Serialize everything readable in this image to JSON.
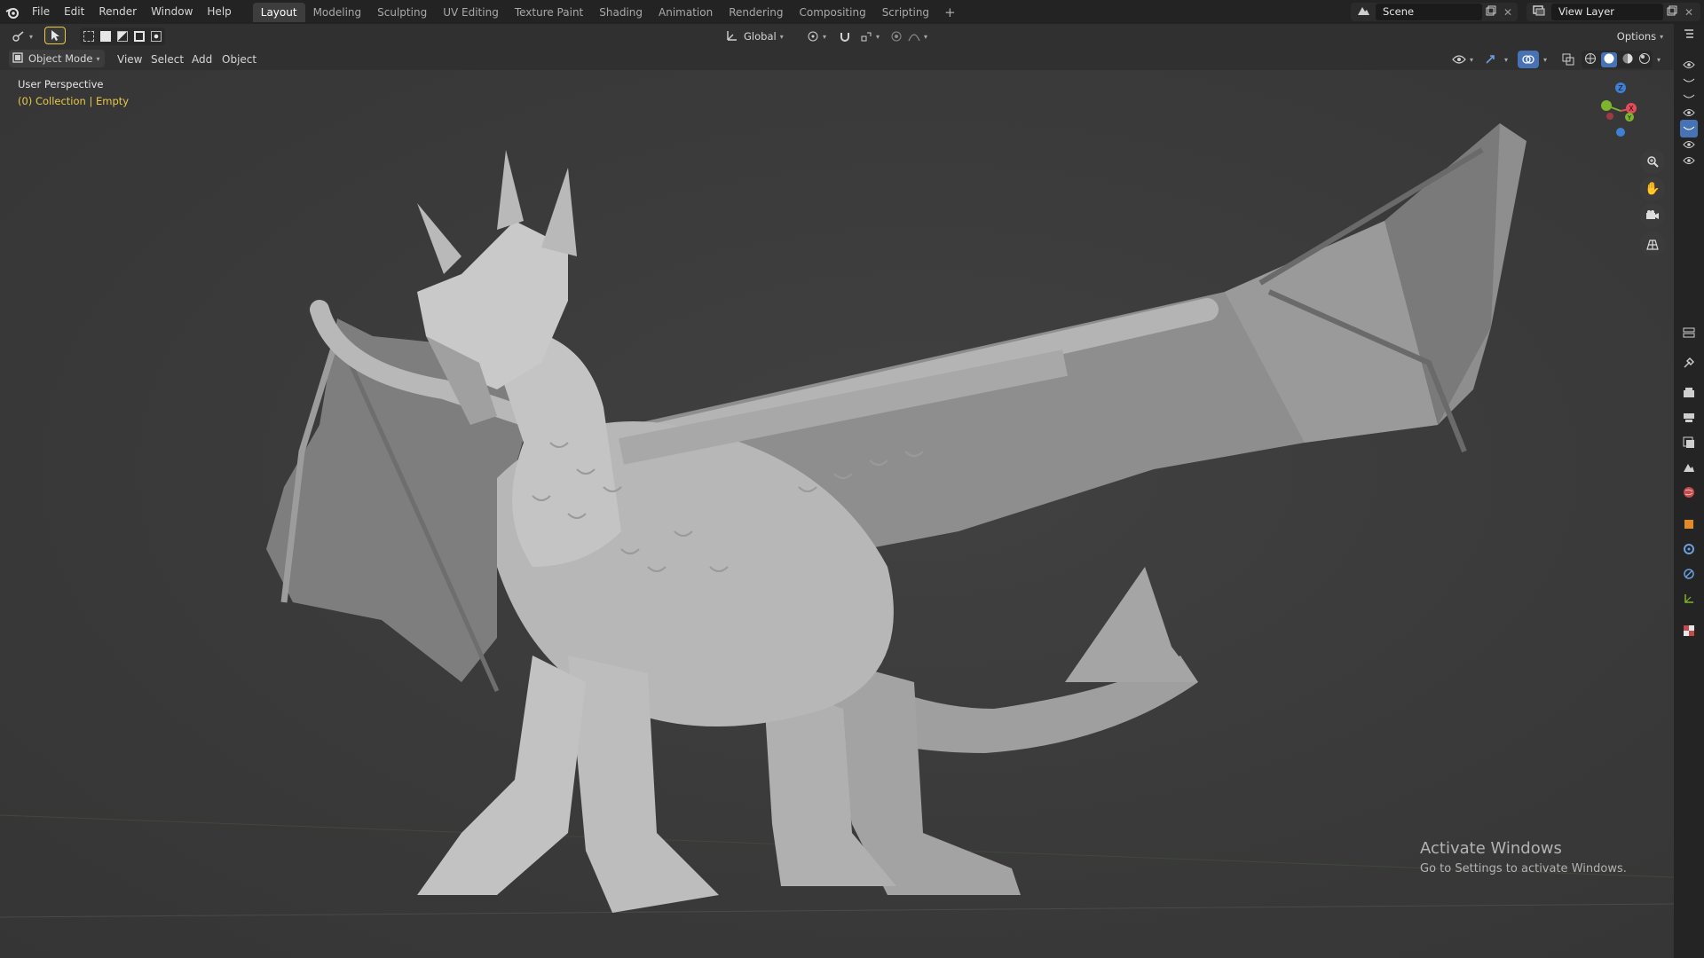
{
  "topbar": {
    "menus": [
      "File",
      "Edit",
      "Render",
      "Window",
      "Help"
    ],
    "workspaces": [
      "Layout",
      "Modeling",
      "Sculpting",
      "UV Editing",
      "Texture Paint",
      "Shading",
      "Animation",
      "Rendering",
      "Compositing",
      "Scripting"
    ],
    "active_workspace": "Layout",
    "add_workspace": "+",
    "scene_name": "Scene",
    "view_layer_name": "View Layer"
  },
  "header": {
    "transform_orientation": "Global",
    "options_label": "Options",
    "mode": "Object Mode",
    "view_menus": [
      "View",
      "Select",
      "Add",
      "Object"
    ]
  },
  "viewport": {
    "perspective_label": "User Perspective",
    "collection_label": "(0) Collection | Empty",
    "gizmo_axes": [
      "Z",
      "X",
      "Y"
    ],
    "watermark_title": "Activate Windows",
    "watermark_sub": "Go to Settings to activate Windows."
  },
  "colors": {
    "accent": "#4772b3",
    "collection_text": "#e8c94a",
    "axis_x": "#e44c5a",
    "axis_y": "#7fb52d",
    "axis_z": "#3f7fd6",
    "model": "#a9a9a9"
  },
  "icons": {
    "nav": [
      "zoom-icon",
      "pan-hand-icon",
      "camera-icon",
      "grid-ortho-icon"
    ],
    "properties": [
      "tool-icon",
      "render-icon",
      "output-icon",
      "view-layer-icon",
      "scene-icon",
      "world-icon",
      "object-icon",
      "modifier-icon",
      "physics-icon",
      "constraint-icon",
      "data-icon",
      "texture-icon"
    ]
  }
}
